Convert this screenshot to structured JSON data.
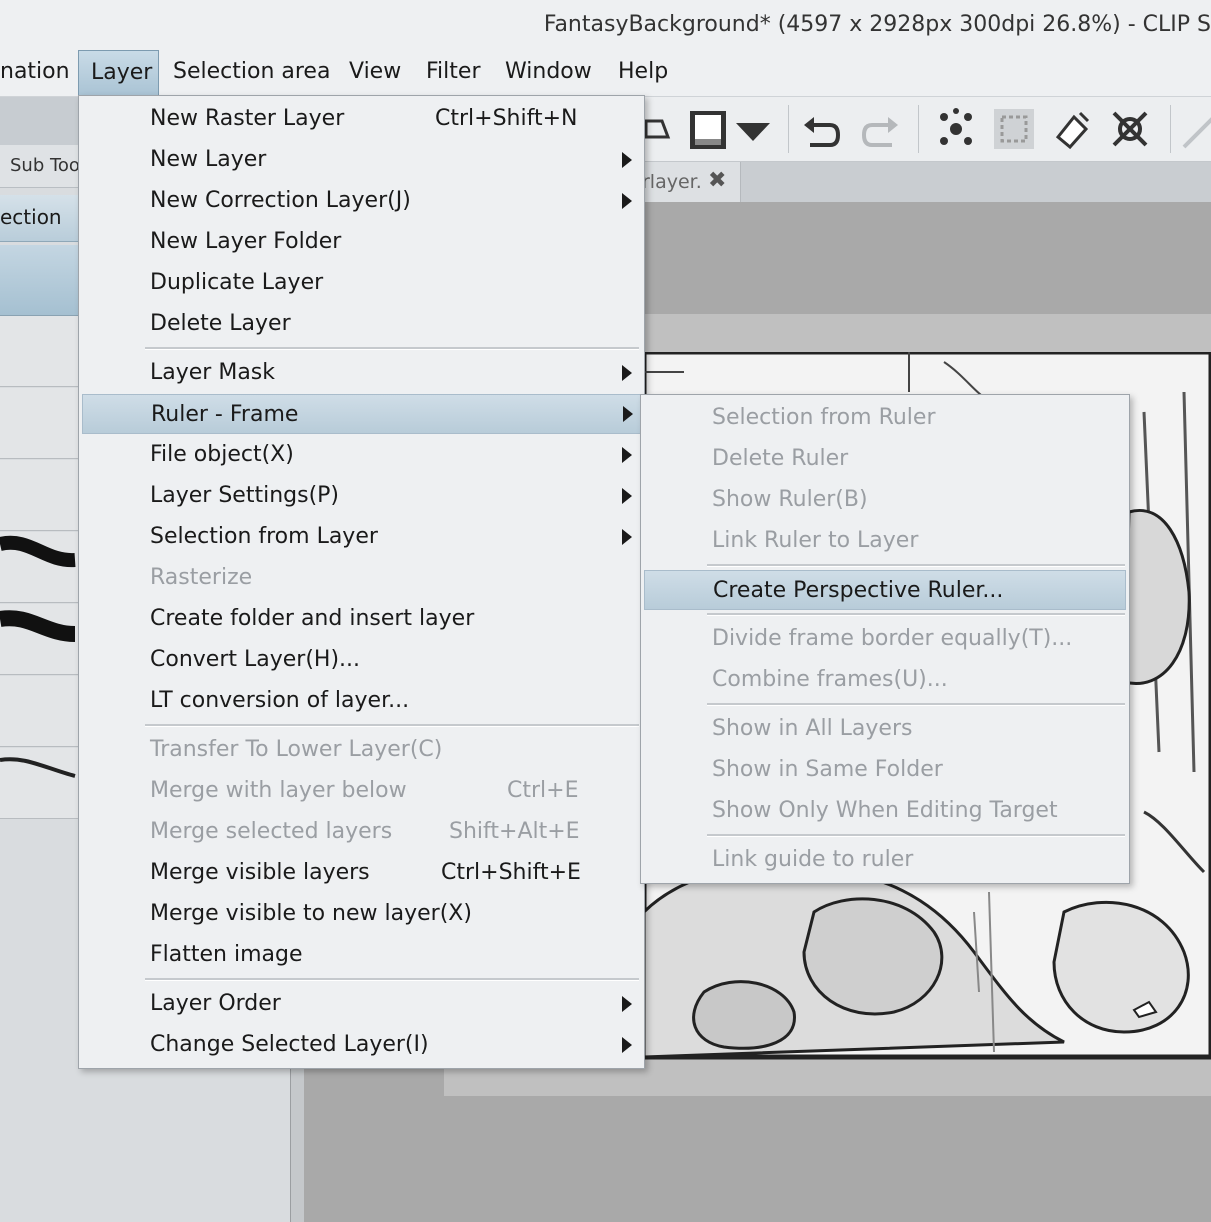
{
  "window": {
    "title": "FantasyBackground* (4597 x 2928px 300dpi 26.8%)  - CLIP S"
  },
  "menubar": {
    "items": [
      {
        "label": "nation"
      },
      {
        "label": "Layer"
      },
      {
        "label": "Selection area"
      },
      {
        "label": "View"
      },
      {
        "label": "Filter"
      },
      {
        "label": "Window"
      },
      {
        "label": "Help"
      }
    ]
  },
  "left_panel": {
    "tab_label": "Sub Too",
    "section_label": "ection"
  },
  "document_tab": {
    "label": "rlayer.",
    "close": "✖"
  },
  "layer_menu": {
    "items": [
      {
        "label": "New Raster Layer",
        "shortcut": "Ctrl+Shift+N"
      },
      {
        "label": "New Layer"
      },
      {
        "label": "New Correction Layer(J)"
      },
      {
        "label": "New Layer Folder"
      },
      {
        "label": "Duplicate Layer"
      },
      {
        "label": "Delete Layer"
      },
      {
        "label": "Layer Mask"
      },
      {
        "label": "Ruler - Frame"
      },
      {
        "label": "File object(X)"
      },
      {
        "label": "Layer Settings(P)"
      },
      {
        "label": "Selection from Layer"
      },
      {
        "label": "Rasterize"
      },
      {
        "label": "Create folder and insert layer"
      },
      {
        "label": "Convert Layer(H)..."
      },
      {
        "label": "LT conversion of layer..."
      },
      {
        "label": "Transfer To Lower Layer(C)"
      },
      {
        "label": "Merge with layer below",
        "shortcut": "Ctrl+E"
      },
      {
        "label": "Merge selected layers",
        "shortcut": "Shift+Alt+E"
      },
      {
        "label": "Merge visible layers",
        "shortcut": "Ctrl+Shift+E"
      },
      {
        "label": "Merge visible to new layer(X)"
      },
      {
        "label": "Flatten image"
      },
      {
        "label": "Layer Order"
      },
      {
        "label": "Change Selected Layer(I)"
      }
    ]
  },
  "ruler_submenu": {
    "items": [
      {
        "label": "Selection from Ruler"
      },
      {
        "label": "Delete Ruler"
      },
      {
        "label": "Show Ruler(B)"
      },
      {
        "label": "Link Ruler to Layer"
      },
      {
        "label": "Create Perspective Ruler..."
      },
      {
        "label": "Divide frame border equally(T)..."
      },
      {
        "label": "Combine frames(U)..."
      },
      {
        "label": "Show in All Layers"
      },
      {
        "label": "Show in Same Folder"
      },
      {
        "label": "Show Only When Editing Target"
      },
      {
        "label": "Link guide to ruler"
      }
    ]
  }
}
